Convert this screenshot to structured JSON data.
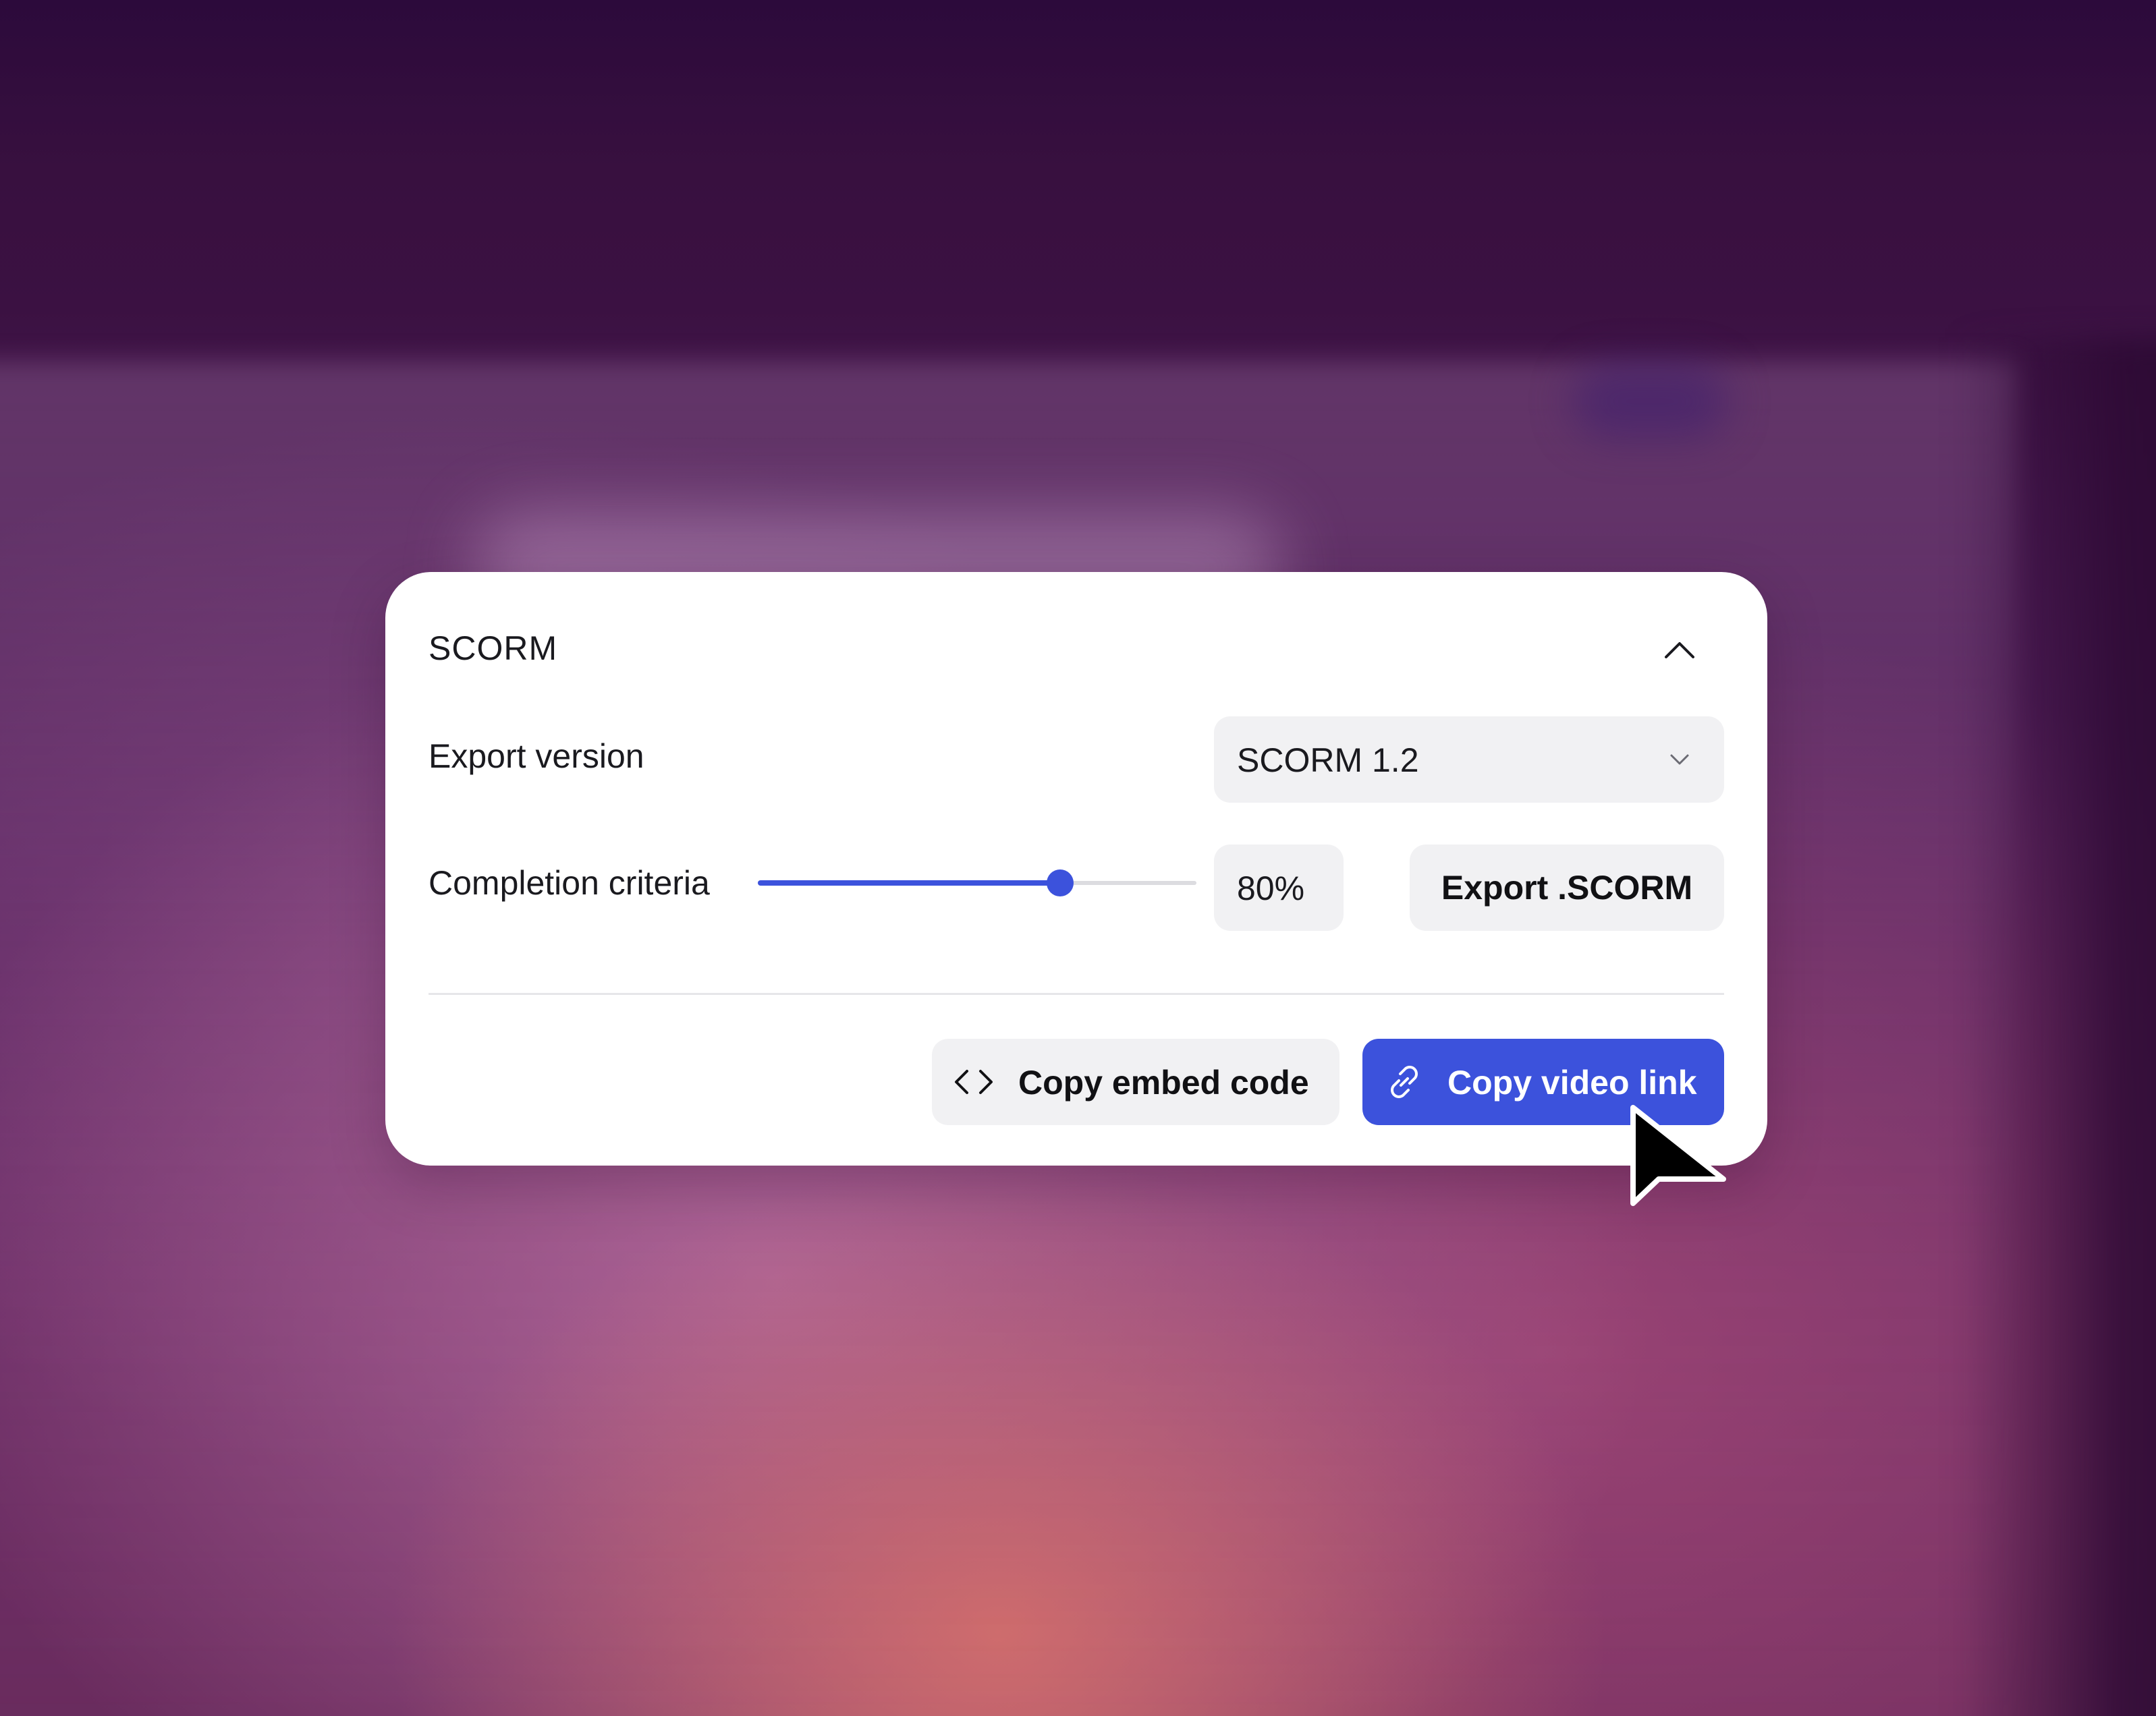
{
  "panel": {
    "title": "SCORM",
    "collapse_icon": "chevron-up-icon"
  },
  "export_version": {
    "label": "Export version",
    "selected": "SCORM 1.2",
    "dropdown_icon": "chevron-down-icon"
  },
  "completion": {
    "label": "Completion criteria",
    "value_text": "80%",
    "slider_fraction": 0.69
  },
  "actions": {
    "export_label": "Export .SCORM",
    "embed_label": "Copy embed code",
    "embed_icon": "code-brackets-icon",
    "link_label": "Copy video link",
    "link_icon": "link-icon"
  },
  "colors": {
    "accent": "#3c52dc",
    "field_bg": "#f1f1f3",
    "card_bg": "#ffffff"
  }
}
